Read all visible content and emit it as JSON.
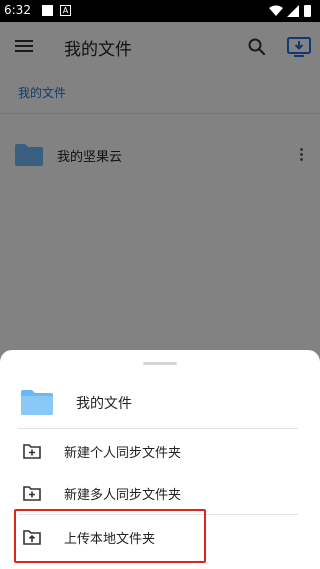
{
  "status_bar": {
    "time": "6:32",
    "a_badge": "A"
  },
  "app_bar": {
    "title": "我的文件"
  },
  "breadcrumb": {
    "label": "我的文件"
  },
  "list": {
    "items": [
      {
        "label": "我的坚果云"
      }
    ]
  },
  "sheet": {
    "header_label": "我的文件",
    "options": [
      {
        "label": "新建个人同步文件夹",
        "icon": "folder-add-icon"
      },
      {
        "label": "新建多人同步文件夹",
        "icon": "folder-add-icon"
      },
      {
        "label": "上传本地文件夹",
        "icon": "folder-upload-icon"
      }
    ]
  },
  "colors": {
    "accent_blue": "#1e6fd9",
    "folder_blue": "#6cb7f5",
    "highlight_red": "#e3241e"
  }
}
